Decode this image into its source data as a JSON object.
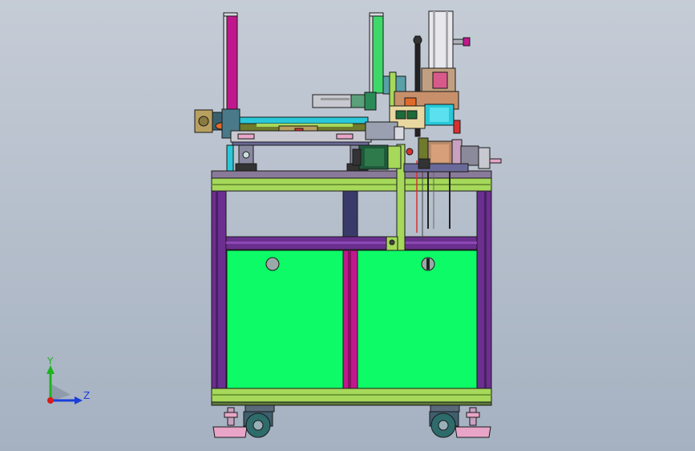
{
  "viewport": {
    "background_top": "#c5ccd6",
    "background_bottom": "#a5b1c1"
  },
  "triad": {
    "y_label": "Y",
    "z_label": "Z",
    "y_color": "#1db41d",
    "z_color": "#1a3fd8",
    "x_color": "#d81a1a"
  },
  "colors": {
    "panel_green": "#0dfb66",
    "profile_purple": "#6b2f8f",
    "rail_green": "#a6d85a",
    "magenta": "#c0188c",
    "pink_foot": "#e8a5c8",
    "caster_teal": "#2e6b6b",
    "cyan": "#28c8d8",
    "olive": "#6e7a2c",
    "outline": "#1a1a1a"
  }
}
